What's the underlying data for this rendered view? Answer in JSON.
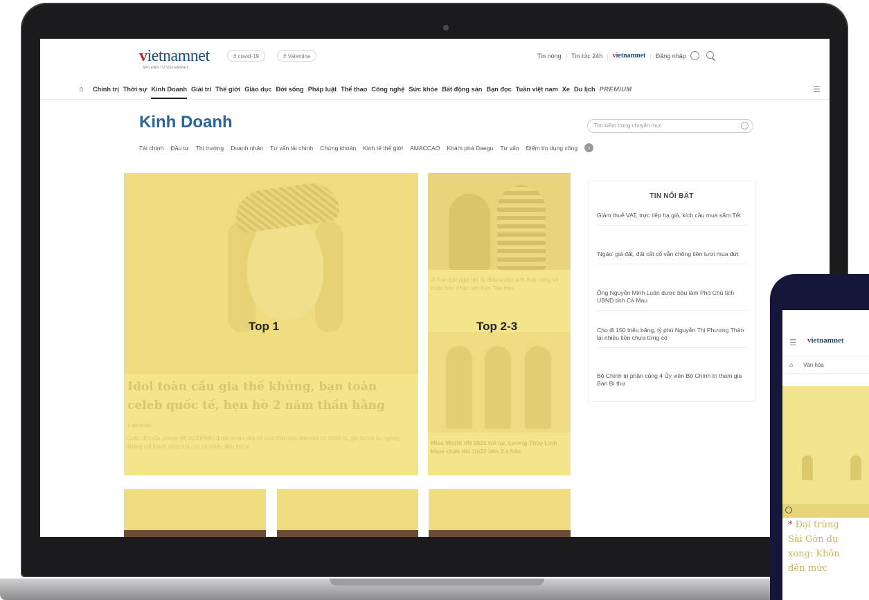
{
  "site": {
    "logo_text": "vietnamnet",
    "logo_tagline": "BÁO ĐIỆN TỬ VIỆTNAMNET",
    "hashtags": [
      "# covid-19",
      "# Valentine"
    ],
    "top_links": [
      "Tin nóng",
      "Tin tức 24h"
    ],
    "mini_logo": "vietnamnet",
    "login_label": "Đăng nhập"
  },
  "nav": {
    "home_icon": "home-icon",
    "items": [
      "Chính trị",
      "Thời sự",
      "Kinh Doanh",
      "Giải trí",
      "Thế giới",
      "Giáo dục",
      "Đời sống",
      "Pháp luật",
      "Thể thao",
      "Công nghệ",
      "Sức khỏe",
      "Bất động sản",
      "Bạn đọc",
      "Tuần việt nam",
      "Xe",
      "Du lịch"
    ],
    "premium": "PREMIUM",
    "active_index": 2
  },
  "section": {
    "title": "Kinh Doanh",
    "search_placeholder": "Tìm kiếm trong chuyên mục",
    "subcategories": [
      "Tài chính",
      "Đầu tư",
      "Thị trường",
      "Doanh nhân",
      "Tư vấn tài chính",
      "Chứng khoán",
      "Kinh tế thế giới",
      "AMACCAO",
      "Khám phá Daegu",
      "Tư vấn",
      "Điểm tín dụng công"
    ]
  },
  "top1": {
    "label": "Top 1",
    "headline": "Idol toàn cầu gia thế khủng, bạn toàn celeb quốc tế, hẹn hò 2 năm thần hằng",
    "meta": "2 giờ trước",
    "description": "Cuộc đời của Jennie (BLACKPINK) được khám phá về xuất thân cho đến nhà có chính trị, gia tộc và sự nghiệp không chỉ thành công mà còn cả nhiều điều thú vị."
  },
  "top23": {
    "label": "Top 2-3",
    "headline1": "Ji Ran bất ngờ tiết lộ điều khiến anh thất vọng về cuộc hôn nhân với Kim Tae Hee",
    "headline2": "Miss World VN 2021 trở lại, Lương Thùy Linh khoe chân dài 1m22 bên 3 á hậu"
  },
  "featured": {
    "title": "TIN NỔI BẬT",
    "items": [
      "Giảm thuế VAT, trực tiếp hạ giá, kích cầu mua sắm Tết",
      "'Ngáo' giá đất, đất cắt cổ vẫn chồng tiền tươi mua đứt",
      "Ông Nguyễn Minh Luân được bầu làm Phó Chủ tịch UBND tỉnh Cà Mau",
      "Cho đi 150 triệu băng, tỷ phú Nguyễn Thị Phương Thảo lại nhiều tiền chưa từng có",
      "Bộ Chính trị phân công 4 Ủy viên Bộ Chính trị tham gia Ban Bí thư"
    ]
  },
  "phone": {
    "logo_text": "vietnamnet",
    "nav_label": "Văn hóa",
    "caption_lines": [
      "Đại trùng",
      "Sài Gòn dự",
      "xong: Khôn",
      "đến mức"
    ]
  }
}
